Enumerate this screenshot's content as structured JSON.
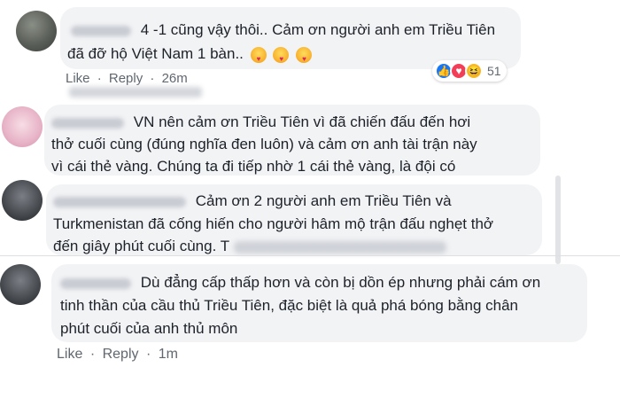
{
  "comments": [
    {
      "text_line1": "4 -1 cũng vậy thôi.. Cảm ơn người anh em Triều Tiên",
      "text_line2": "đã đỡ hộ Việt Nam 1 bàn..",
      "actions": {
        "like": "Like",
        "sep1": "·",
        "reply": "Reply",
        "sep2": "·",
        "time": "26m"
      },
      "reaction_count": "51"
    },
    {
      "text_line1": "VN nên cảm ơn Triều Tiên vì đã chiến đấu đến hơi",
      "text_line2": "thở cuối cùng (đúng nghĩa đen luôn) và cảm ơn anh tài trận này",
      "text_line3": "vì cái thẻ vàng. Chúng ta đi tiếp nhờ 1 cái thẻ vàng, là đội có"
    },
    {
      "text_line1": "Cảm ơn 2 người anh em Triều Tiên và",
      "text_line2": "Turkmenistan đã cống hiến cho người hâm mộ trận đấu nghẹt thở",
      "text_line3": "đến giây phút cuối cùng. T"
    },
    {
      "text_line1": "Dù đẳng cấp thấp hơn và còn bị dồn ép nhưng phải cám ơn",
      "text_line2": "tinh thần của cầu thủ Triều Tiên, đặc biệt là quả phá bóng bằng chân",
      "text_line3": "phút cuối của anh thủ môn",
      "actions": {
        "like": "Like",
        "sep1": "·",
        "reply": "Reply",
        "sep2": "·",
        "time": "1m"
      }
    }
  ],
  "colors": {
    "bubble": "#f2f3f5",
    "meta": "#606770",
    "like_blue": "#1877f2",
    "love_red": "#f33e58"
  }
}
